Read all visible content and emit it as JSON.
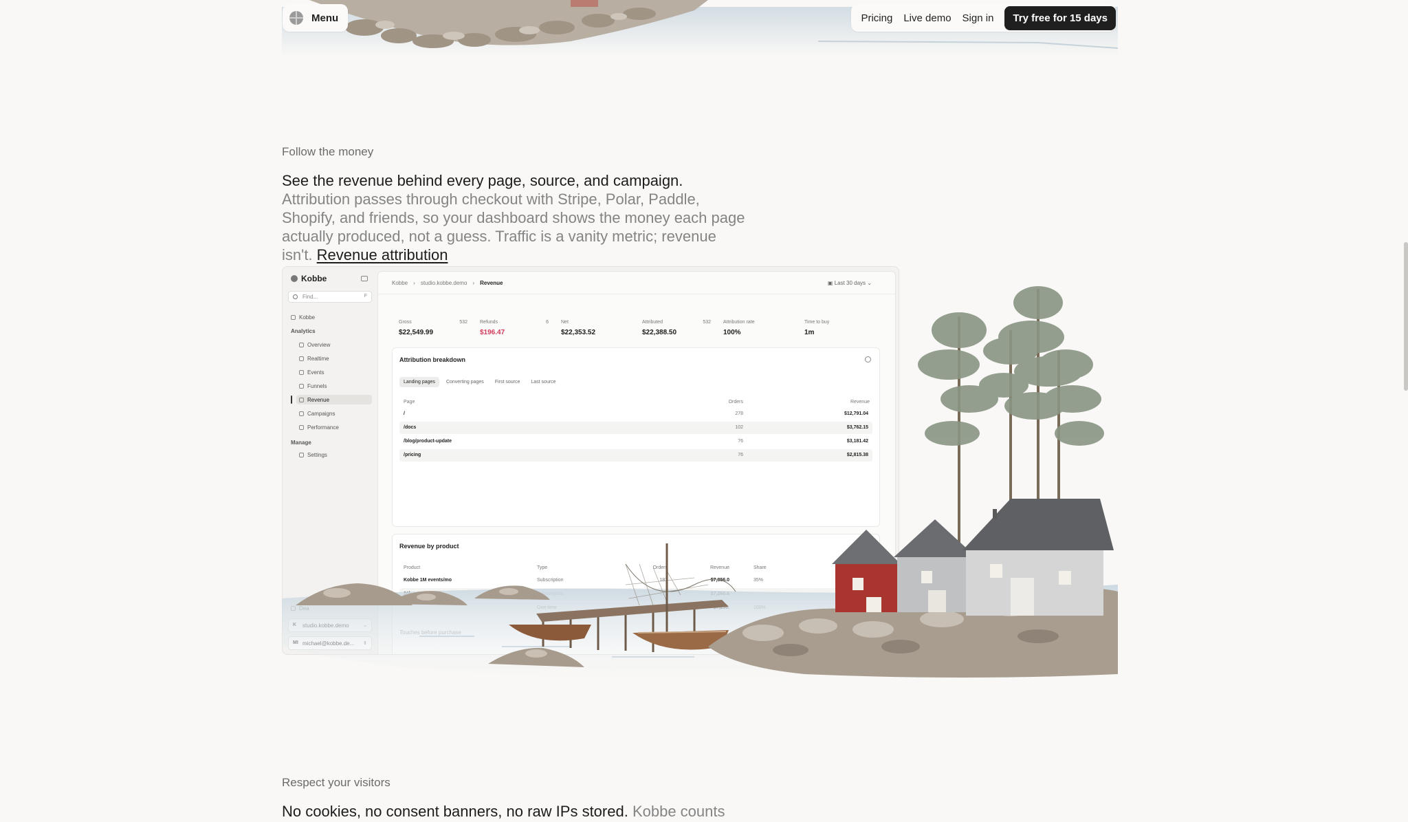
{
  "nav": {
    "menu_label": "Menu",
    "links": [
      "Pricing",
      "Live demo",
      "Sign in"
    ],
    "cta": "Try free for 15 days"
  },
  "section1": {
    "eyebrow": "Follow the money",
    "lead_strong": "See the revenue behind every page, source, and campaign.",
    "lead_muted": " Attribution passes through checkout with Stripe, Polar, Paddle, Shopify, and friends, so your dashboard shows the money each page actually produced, not a guess. Traffic is a vanity metric; revenue isn't. ",
    "link": "Revenue attribution"
  },
  "dashboard": {
    "brand": "Kobbe",
    "find_placeholder": "Find...",
    "find_kbd": "F",
    "home": "Kobbe",
    "group_analytics": "Analytics",
    "analytics_items": [
      "Overview",
      "Realtime",
      "Events",
      "Funnels",
      "Revenue",
      "Campaigns",
      "Performance"
    ],
    "group_manage": "Manage",
    "manage_items": [
      "Settings"
    ],
    "bottom_partial": "Dea",
    "site": "studio.kobbe.demo",
    "site_initial": "K",
    "user": "michael@kobbe.de...",
    "user_initial": "MI",
    "breadcrumb": [
      "Kobbe",
      "studio.kobbe.demo",
      "Revenue"
    ],
    "range": "Last 30 days",
    "kpis": [
      {
        "label": "Gross",
        "count": "532",
        "value": "$22,549.99"
      },
      {
        "label": "Refunds",
        "count": "6",
        "value": "$196.47"
      },
      {
        "label": "Net",
        "count": "",
        "value": "$22,353.52"
      },
      {
        "label": "Attributed",
        "count": "532",
        "value": "$22,388.50"
      },
      {
        "label": "Attribution rate",
        "count": "",
        "value": "100%"
      },
      {
        "label": "Time to buy",
        "count": "",
        "value": "1m"
      }
    ],
    "attribution": {
      "title": "Attribution breakdown",
      "tabs": [
        "Landing pages",
        "Converting pages",
        "First source",
        "Last source"
      ],
      "headers": [
        "Page",
        "Orders",
        "Revenue"
      ],
      "rows": [
        {
          "page": "/",
          "orders": "278",
          "revenue": "$12,791.04"
        },
        {
          "page": "/docs",
          "orders": "102",
          "revenue": "$3,762.15"
        },
        {
          "page": "/blog/product-update",
          "orders": "76",
          "revenue": "$3,181.42"
        },
        {
          "page": "/pricing",
          "orders": "76",
          "revenue": "$2,815.38"
        }
      ]
    },
    "products": {
      "title": "Revenue by product",
      "headers": [
        "Product",
        "Type",
        "Orders",
        "Revenue",
        "Share"
      ],
      "rows": [
        {
          "product": "Kobbe 1M events/mo",
          "type": "Subscription",
          "orders": "187",
          "revenue": "$7,856.0",
          "share": "35%"
        },
        {
          "product": "20k events/mo",
          "type": "Subscription",
          "orders": "177",
          "revenue": "$7,260.6",
          "share": ""
        },
        {
          "product": "",
          "type": "One-time",
          "orders": "168",
          "revenue": "$7,236.",
          "share": "100%"
        }
      ],
      "touches": "Touches before purchase"
    }
  },
  "section2": {
    "eyebrow": "Respect your visitors",
    "lead_strong": "No cookies, no consent banners, no raw IPs stored.",
    "lead_muted": " Kobbe counts visits"
  }
}
